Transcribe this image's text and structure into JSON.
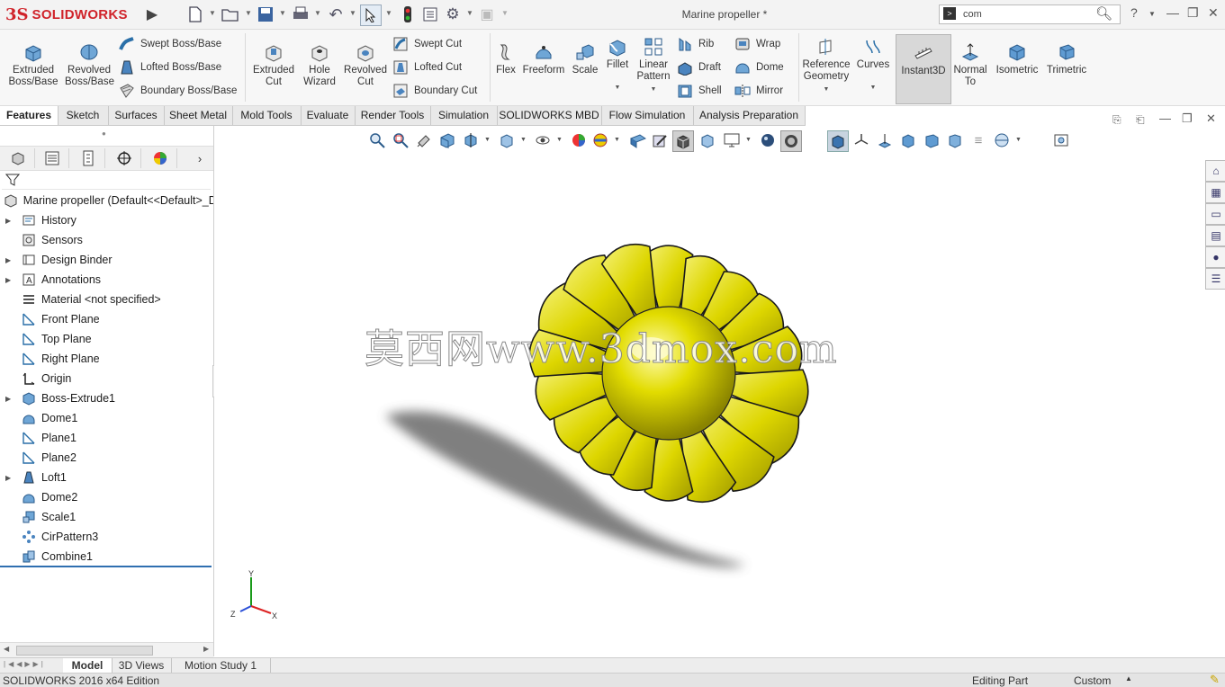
{
  "app": {
    "brand_ds": "3S",
    "brand_name": "SOLIDWORKS",
    "document_title": "Marine propeller *"
  },
  "search": {
    "value": "com"
  },
  "ribbon": {
    "extruded_boss": "Extruded Boss/Base",
    "revolved_boss": "Revolved Boss/Base",
    "swept_boss": "Swept Boss/Base",
    "lofted_boss": "Lofted Boss/Base",
    "boundary_boss": "Boundary Boss/Base",
    "extruded_cut": "Extruded Cut",
    "hole_wizard": "Hole Wizard",
    "revolved_cut": "Revolved Cut",
    "swept_cut": "Swept Cut",
    "lofted_cut": "Lofted Cut",
    "boundary_cut": "Boundary Cut",
    "flex": "Flex",
    "freeform": "Freeform",
    "scale": "Scale",
    "fillet": "Fillet",
    "linear_pattern": "Linear Pattern",
    "rib": "Rib",
    "draft": "Draft",
    "shell": "Shell",
    "wrap": "Wrap",
    "dome": "Dome",
    "mirror": "Mirror",
    "reference_geometry": "Reference Geometry",
    "curves": "Curves",
    "instant3d": "Instant3D",
    "normal_to": "Normal To",
    "isometric": "Isometric",
    "trimetric": "Trimetric"
  },
  "tabs": [
    "Features",
    "Sketch",
    "Surfaces",
    "Sheet Metal",
    "Mold Tools",
    "Evaluate",
    "Render Tools",
    "Simulation",
    "SOLIDWORKS MBD",
    "Flow Simulation",
    "Analysis Preparation"
  ],
  "tree": {
    "root": "Marine propeller  (Default<<Default>_D",
    "items": [
      {
        "label": "History",
        "icon": "history-icon"
      },
      {
        "label": "Sensors",
        "icon": "sensors-icon"
      },
      {
        "label": "Design Binder",
        "icon": "binder-icon"
      },
      {
        "label": "Annotations",
        "icon": "annotations-icon"
      },
      {
        "label": "Material <not specified>",
        "icon": "material-icon"
      },
      {
        "label": "Front Plane",
        "icon": "plane-icon"
      },
      {
        "label": "Top Plane",
        "icon": "plane-icon"
      },
      {
        "label": "Right Plane",
        "icon": "plane-icon"
      },
      {
        "label": "Origin",
        "icon": "origin-icon"
      },
      {
        "label": "Boss-Extrude1",
        "icon": "extrude-icon"
      },
      {
        "label": "Dome1",
        "icon": "dome-icon"
      },
      {
        "label": "Plane1",
        "icon": "plane-icon"
      },
      {
        "label": "Plane2",
        "icon": "plane-icon"
      },
      {
        "label": "Loft1",
        "icon": "loft-icon"
      },
      {
        "label": "Dome2",
        "icon": "dome-icon"
      },
      {
        "label": "Scale1",
        "icon": "scale-icon"
      },
      {
        "label": "CirPattern3",
        "icon": "pattern-icon"
      },
      {
        "label": "Combine1",
        "icon": "combine-icon"
      }
    ]
  },
  "watermark": "莫西网www.3dmox.com",
  "triad": {
    "y": "Y",
    "x": "X",
    "z": "Z"
  },
  "bottom_tabs": [
    "Model",
    "3D Views",
    "Motion Study 1"
  ],
  "status": {
    "edition": "SOLIDWORKS 2016 x64 Edition",
    "mode": "Editing Part",
    "units": "Custom"
  },
  "colors": {
    "model": "#e6e000",
    "brand": "#d0232a",
    "accent": "#2a6fa8"
  }
}
